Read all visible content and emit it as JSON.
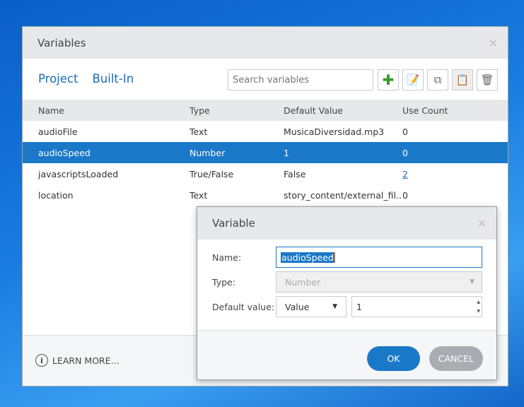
{
  "window": {
    "title": "Variables",
    "close": "×"
  },
  "tabs": [
    "Project",
    "Built-In"
  ],
  "search": {
    "placeholder": "Search variables"
  },
  "toolbar": [
    "add-icon",
    "edit-icon",
    "copy-icon",
    "paste-icon",
    "trash-icon"
  ],
  "table": {
    "headers": [
      "Name",
      "Type",
      "Default Value",
      "Use Count"
    ],
    "rows": [
      [
        "audioFile",
        "Text",
        "MusicaDiversidad.mp3",
        "0"
      ],
      [
        "audioSpeed",
        "Number",
        "1",
        "0"
      ],
      [
        "javascriptsLoaded",
        "True/False",
        "False",
        "2"
      ],
      [
        "location",
        "Text",
        "story_content/external_fil...",
        "0"
      ]
    ]
  },
  "learn_more": "LEARN MORE...",
  "dialog": {
    "title": "Variable",
    "close": "×",
    "name_label": "Name:",
    "name_value": "audioSpeed",
    "type_label": "Type:",
    "type_value": "Number",
    "default_label": "Default value:",
    "default_mode": "Value",
    "default_value": "1",
    "ok": "OK",
    "cancel": "CANCEL"
  },
  "colors": {
    "accent": "#1a78c8",
    "ok": "#1a78c8",
    "cancel": "#a9adb1"
  }
}
